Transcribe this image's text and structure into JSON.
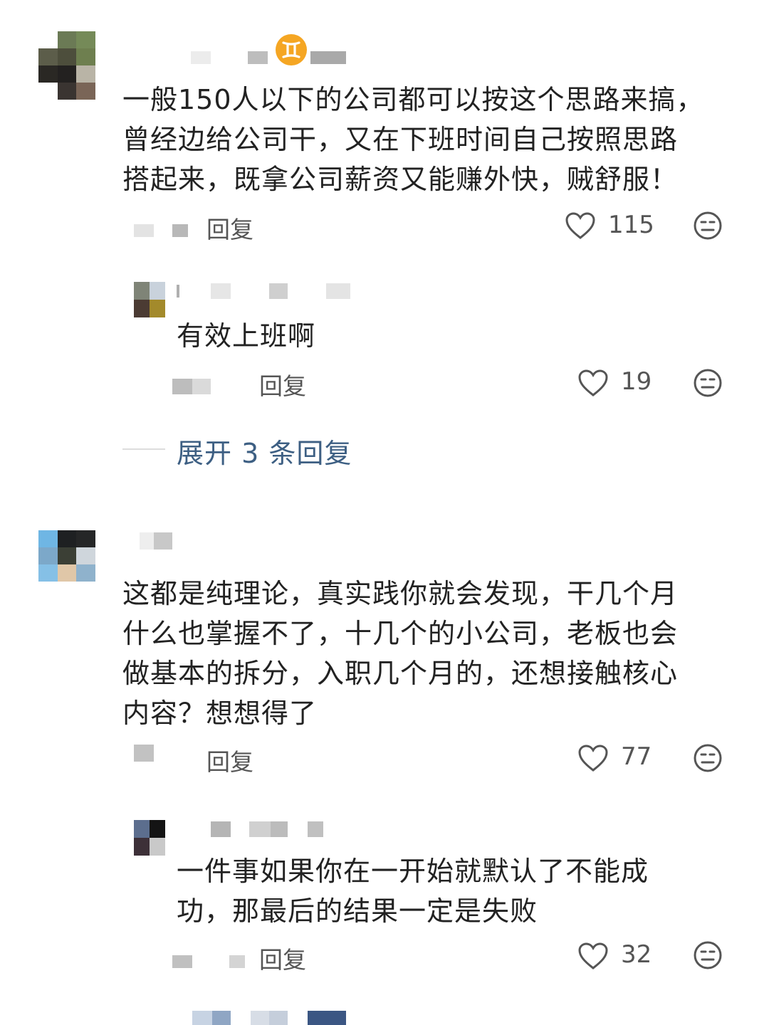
{
  "comments": [
    {
      "text": "一般150人以下的公司都可以按这个思路来搞，\n曾经边给公司干，又在下班时间自己按照思路\n搭起来，既拿公司薪资又能赚外快，贼舒服！",
      "reply_label": "回复",
      "likes": "115",
      "badge_icon": "gemini-zodiac-icon",
      "replies": [
        {
          "text": "有效上班啊",
          "reply_label": "回复",
          "likes": "19"
        }
      ],
      "expand_label": "展开 3 条回复"
    },
    {
      "text": "这都是纯理论，真实践你就会发现，干几个月\n什么也掌握不了，十几个的小公司，老板也会\n做基本的拆分，入职几个月的，还想接触核心\n内容？想想得了",
      "reply_label": "回复",
      "likes": "77",
      "replies": [
        {
          "text": "一件事如果你在一开始就默认了不能成\n功，那最后的结果一定是失败",
          "reply_label": "回复",
          "likes": "32"
        }
      ]
    }
  ],
  "colors": {
    "accent_link": "#3d5f83",
    "badge": "#f5a623"
  }
}
